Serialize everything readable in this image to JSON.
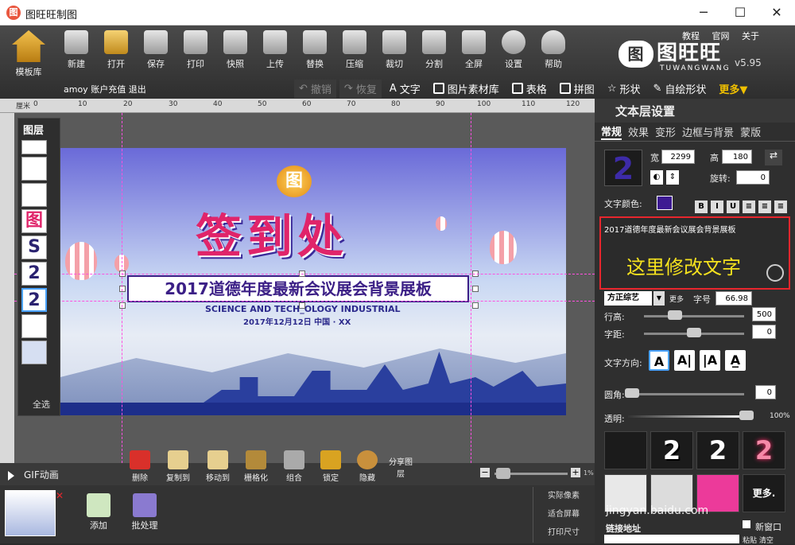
{
  "window": {
    "title": "图旺旺制图",
    "logo": "图",
    "min": "─",
    "max": "☐",
    "close": "✕"
  },
  "toolbar": {
    "home": "模板库",
    "items": [
      "新建",
      "打开",
      "保存",
      "打印",
      "快照",
      "上传",
      "替换",
      "压缩",
      "裁切",
      "分割",
      "全屏",
      "设置",
      "帮助"
    ]
  },
  "brand": {
    "name": "图旺旺",
    "mark": "图",
    "en": "TUWANGWANG",
    "version": "v5.95"
  },
  "toplinks": [
    "教程",
    "官网",
    "关于"
  ],
  "user": {
    "text": "amoy 账户充值 退出"
  },
  "subbar": {
    "undo": "撤销",
    "redo": "恢复",
    "text": "文字",
    "material": "图片素材库",
    "table": "表格",
    "collage": "拼图",
    "shape": "形状",
    "custom_shape": "自绘形状",
    "more": "更多▼"
  },
  "ruler": {
    "unit": "厘米",
    "ticks": [
      "0",
      "10",
      "20",
      "30",
      "40",
      "50",
      "60",
      "70",
      "80",
      "90",
      "100",
      "110",
      "120",
      "130"
    ]
  },
  "layers": {
    "title": "图层",
    "items": [
      "",
      "",
      "",
      "图",
      "S",
      "2",
      "2",
      "",
      ""
    ],
    "select_all": "全选"
  },
  "poster": {
    "main": "签到处",
    "logo": "图",
    "subtitle": "2017道德年度最新会议展会背景展板",
    "english": "SCIENCE AND TECH_OLOGY INDUSTRIAL",
    "date": "2017年12月12日  中国 · XX"
  },
  "bottom": {
    "gif": "GIF动画",
    "actions": [
      "删除",
      "复制到",
      "移动到",
      "栅格化",
      "组合",
      "锁定",
      "隐藏"
    ],
    "share": "分享图层",
    "zoom_minus": "−",
    "zoom_plus": "+",
    "zoom_pct": "1%"
  },
  "footer": {
    "add": "添加",
    "batch": "批处理",
    "sizes": [
      "实际像素",
      "适合屏幕",
      "打印尺寸"
    ]
  },
  "right": {
    "header": "文本层设置",
    "tabs": [
      "常规",
      "效果",
      "变形",
      "边框与背景",
      "蒙版"
    ],
    "width_label": "宽",
    "width": "2299",
    "height_label": "高",
    "height": "180",
    "rotate_label": "旋转:",
    "rotate": "0",
    "color_label": "文字颜色:",
    "preview": "2",
    "text_small": "2017道德年度最新会议展会背景展板",
    "text_big": "这里修改文字",
    "font": "方正综艺",
    "font_more": "更多",
    "size_label": "字号",
    "size": "66.98",
    "line_label": "行高:",
    "line": "500",
    "spacing_label": "字距:",
    "spacing": "0",
    "dir_label": "文字方向:",
    "radius_label": "圆角:",
    "radius": "0",
    "opacity_label": "透明:",
    "opacity": "100%",
    "styles": [
      "",
      "2",
      "2",
      "2",
      "",
      "",
      "",
      "更多."
    ],
    "link_label": "链接地址",
    "new_window": "新窗口",
    "paste": "粘贴 清空"
  },
  "watermark": "jingyan.baidu.com"
}
